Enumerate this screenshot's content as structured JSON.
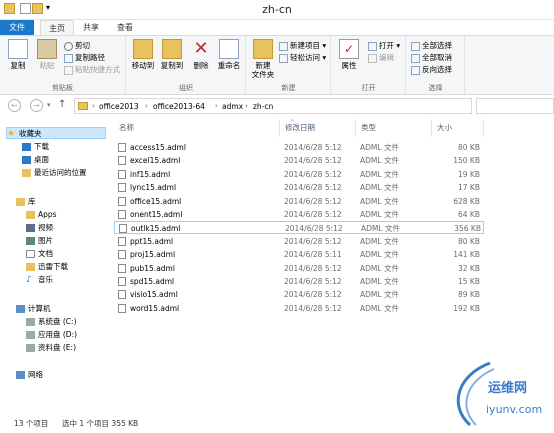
{
  "window": {
    "title": "zh-cn"
  },
  "ribbon_tabs": [
    "文件",
    "主页",
    "共享",
    "查看"
  ],
  "ribbon": {
    "clipboard": {
      "label": "剪贴板",
      "copy": "复制",
      "paste": "粘贴",
      "cut": "剪切",
      "copy_path": "复制路径",
      "paste_shortcut": "粘贴快捷方式"
    },
    "organize": {
      "label": "组织",
      "move_to": "移动到",
      "copy_to": "复制到",
      "delete": "删除",
      "rename": "重命名"
    },
    "new": {
      "label": "新建",
      "new_folder": "新建\n文件夹",
      "new_item": "新建项目 ▾",
      "easy_access": "轻松访问 ▾"
    },
    "open": {
      "label": "打开",
      "properties": "属性",
      "open": "打开 ▾",
      "edit": "编辑"
    },
    "select": {
      "label": "选择",
      "select_all": "全部选择",
      "select_none": "全部取消",
      "invert": "反向选择"
    }
  },
  "breadcrumb": [
    "office2013",
    "office2013-64",
    "admx",
    "zh-cn"
  ],
  "nav": {
    "favorites": "收藏夹",
    "favorites_items": [
      "下载",
      "桌面",
      "最近访问的位置"
    ],
    "libraries": "库",
    "library_items": [
      "Apps",
      "视频",
      "图片",
      "文档",
      "迅雷下载",
      "音乐"
    ],
    "computer": "计算机",
    "computer_items": [
      "系统盘 (C:)",
      "应用盘 (D:)",
      "资料盘 (E:)"
    ],
    "network": "网络"
  },
  "columns": {
    "name": "名称",
    "date": "修改日期",
    "type": "类型",
    "size": "大小"
  },
  "files": [
    {
      "name": "access15.adml",
      "date": "2014/6/28 5:12",
      "type": "ADML 文件",
      "size": "80 KB"
    },
    {
      "name": "excel15.adml",
      "date": "2014/6/28 5:12",
      "type": "ADML 文件",
      "size": "150 KB"
    },
    {
      "name": "inf15.adml",
      "date": "2014/6/28 5:12",
      "type": "ADML 文件",
      "size": "19 KB"
    },
    {
      "name": "lync15.adml",
      "date": "2014/6/28 5:12",
      "type": "ADML 文件",
      "size": "17 KB"
    },
    {
      "name": "office15.adml",
      "date": "2014/6/28 5:12",
      "type": "ADML 文件",
      "size": "628 KB"
    },
    {
      "name": "onent15.adml",
      "date": "2014/6/28 5:12",
      "type": "ADML 文件",
      "size": "64 KB"
    },
    {
      "name": "outlk15.adml",
      "date": "2014/6/28 5:12",
      "type": "ADML 文件",
      "size": "356 KB"
    },
    {
      "name": "ppt15.adml",
      "date": "2014/6/28 5:12",
      "type": "ADML 文件",
      "size": "80 KB"
    },
    {
      "name": "proj15.adml",
      "date": "2014/6/28 5:11",
      "type": "ADML 文件",
      "size": "141 KB"
    },
    {
      "name": "pub15.adml",
      "date": "2014/6/28 5:12",
      "type": "ADML 文件",
      "size": "32 KB"
    },
    {
      "name": "spd15.adml",
      "date": "2014/6/28 5:12",
      "type": "ADML 文件",
      "size": "15 KB"
    },
    {
      "name": "visio15.adml",
      "date": "2014/6/28 5:12",
      "type": "ADML 文件",
      "size": "89 KB"
    },
    {
      "name": "word15.adml",
      "date": "2014/6/28 5:12",
      "type": "ADML 文件",
      "size": "192 KB"
    }
  ],
  "status": {
    "count": "13 个项目",
    "selection": "选中 1 个项目  355 KB"
  },
  "watermark": {
    "cn": "运维网",
    "en": "iyunv.com"
  },
  "colors": {
    "file_tab": "#1979ca",
    "selection": "#cce8ff",
    "selection_border": "#99d1ff",
    "folder": "#e8c25c"
  }
}
